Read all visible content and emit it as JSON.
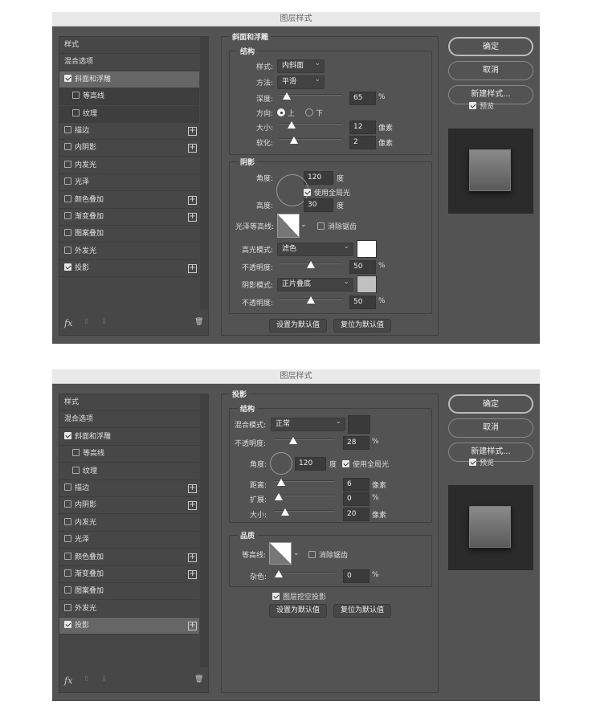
{
  "dialogs": [
    {
      "title": "图层样式",
      "sidebar": {
        "items": [
          {
            "label": "样式",
            "checkbox": false,
            "plus": false,
            "selected": false
          },
          {
            "label": "混合选项",
            "checkbox": false,
            "plus": false
          },
          {
            "label": "斜面和浮雕",
            "checkbox": true,
            "checked": true,
            "plus": false,
            "selected": true
          },
          {
            "label": "等高线",
            "checkbox": true,
            "checked": false,
            "sub": true
          },
          {
            "label": "纹理",
            "checkbox": true,
            "checked": false,
            "sub": true
          },
          {
            "label": "描边",
            "checkbox": true,
            "checked": false,
            "plus": true
          },
          {
            "label": "内阴影",
            "checkbox": true,
            "checked": false,
            "plus": true
          },
          {
            "label": "内发光",
            "checkbox": true,
            "checked": false
          },
          {
            "label": "光泽",
            "checkbox": true,
            "checked": false
          },
          {
            "label": "颜色叠加",
            "checkbox": true,
            "checked": false,
            "plus": true
          },
          {
            "label": "渐变叠加",
            "checkbox": true,
            "checked": false,
            "plus": true
          },
          {
            "label": "图案叠加",
            "checkbox": true,
            "checked": false
          },
          {
            "label": "外发光",
            "checkbox": true,
            "checked": false
          },
          {
            "label": "投影",
            "checkbox": true,
            "checked": true,
            "plus": true
          }
        ],
        "footer_icons": [
          "fx-icon",
          "arrow-up-icon",
          "arrow-down-icon",
          "trash-icon"
        ],
        "fx": "fx"
      },
      "panel": {
        "title": "斜面和浮雕",
        "structure": {
          "title": "结构",
          "style_label": "样式:",
          "style_value": "内斜面",
          "technique_label": "方法:",
          "technique_value": "平滑",
          "depth_label": "深度:",
          "depth_value": "65",
          "depth_unit": "%",
          "depth_slider": 0.06,
          "direction_label": "方向:",
          "dir_up": "上",
          "dir_down": "下",
          "direction_selected": "上",
          "size_label": "大小:",
          "size_value": "12",
          "size_unit": "像素",
          "size_slider": 0.15,
          "soften_label": "软化:",
          "soften_value": "2",
          "soften_unit": "像素",
          "soften_slider": 0.2
        },
        "shading": {
          "title": "阴影",
          "angle_label": "角度:",
          "angle_value": "120",
          "angle_unit": "度",
          "global_light_label": "使用全局光",
          "global_light_checked": true,
          "altitude_label": "高度:",
          "altitude_value": "30",
          "altitude_unit": "度",
          "gloss_label": "光泽等高线:",
          "antialias_label": "消除锯齿",
          "antialias_checked": false,
          "highlight_label": "高光模式:",
          "highlight_value": "滤色",
          "highlight_color": "#ffffff",
          "hl_opacity_label": "不透明度:",
          "hl_opacity_value": "50",
          "hl_opacity_unit": "%",
          "hl_opacity_slider": 0.5,
          "shadow_label": "阴影模式:",
          "shadow_value": "正片叠底",
          "shadow_color": "#c0c0c0",
          "sh_opacity_label": "不透明度:",
          "sh_opacity_value": "50",
          "sh_opacity_unit": "%",
          "sh_opacity_slider": 0.5
        },
        "make_default": "设置为默认值",
        "reset_default": "复位为默认值"
      },
      "buttons": {
        "ok": "确定",
        "cancel": "取消",
        "new_style": "新建样式...",
        "preview": "预览",
        "preview_checked": true
      }
    },
    {
      "title": "图层样式",
      "sidebar": {
        "items": [
          {
            "label": "样式",
            "checkbox": false
          },
          {
            "label": "混合选项",
            "checkbox": false
          },
          {
            "label": "斜面和浮雕",
            "checkbox": true,
            "checked": true
          },
          {
            "label": "等高线",
            "checkbox": true,
            "checked": false,
            "subplain": true
          },
          {
            "label": "纹理",
            "checkbox": true,
            "checked": false,
            "subplain": true
          },
          {
            "label": "描边",
            "checkbox": true,
            "checked": false,
            "plus": true
          },
          {
            "label": "内阴影",
            "checkbox": true,
            "checked": false,
            "plus": true
          },
          {
            "label": "内发光",
            "checkbox": true,
            "checked": false
          },
          {
            "label": "光泽",
            "checkbox": true,
            "checked": false
          },
          {
            "label": "颜色叠加",
            "checkbox": true,
            "checked": false,
            "plus": true
          },
          {
            "label": "渐变叠加",
            "checkbox": true,
            "checked": false,
            "plus": true
          },
          {
            "label": "图案叠加",
            "checkbox": true,
            "checked": false
          },
          {
            "label": "外发光",
            "checkbox": true,
            "checked": false
          },
          {
            "label": "投影",
            "checkbox": true,
            "checked": true,
            "plus": true,
            "selected": true
          }
        ],
        "fx": "fx"
      },
      "panel": {
        "title": "投影",
        "structure": {
          "title": "结构",
          "blend_label": "混合模式:",
          "blend_value": "正常",
          "blend_color": "#3a3a3a",
          "opacity_label": "不透明度:",
          "opacity_value": "28",
          "opacity_unit": "%",
          "opacity_slider": 0.28,
          "angle_label": "角度:",
          "angle_value": "120",
          "angle_unit": "度",
          "global_light_label": "使用全局光",
          "global_light_checked": true,
          "distance_label": "距离:",
          "distance_value": "6",
          "distance_unit": "像素",
          "distance_slider": 0.04,
          "spread_label": "扩展:",
          "spread_value": "0",
          "spread_unit": "%",
          "spread_slider": 0,
          "size_label": "大小:",
          "size_value": "20",
          "size_unit": "像素",
          "size_slider": 0.12
        },
        "quality": {
          "title": "品质",
          "contour_label": "等高线:",
          "antialias_label": "消除锯齿",
          "antialias_checked": false,
          "noise_label": "杂色:",
          "noise_value": "0",
          "noise_unit": "%",
          "noise_slider": 0
        },
        "knockout_label": "图层挖空投影",
        "knockout_checked": true,
        "make_default": "设置为默认值",
        "reset_default": "复位为默认值"
      },
      "buttons": {
        "ok": "确定",
        "cancel": "取消",
        "new_style": "新建样式...",
        "preview": "预览",
        "preview_checked": true
      }
    }
  ]
}
